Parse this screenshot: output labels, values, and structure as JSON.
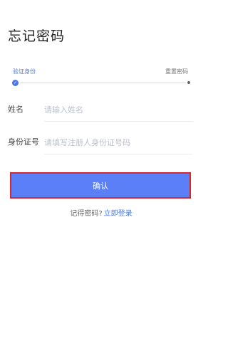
{
  "page": {
    "title": "忘记密码"
  },
  "steps": {
    "items": [
      {
        "label": "验证身份",
        "state": "active"
      },
      {
        "label": "重置密码",
        "state": "pending"
      }
    ],
    "check_glyph": "✓"
  },
  "form": {
    "name": {
      "label": "姓名",
      "value": "",
      "placeholder": "请输入姓名"
    },
    "id_number": {
      "label": "身份证号",
      "value": "",
      "placeholder": "请填写注册人身份证号码"
    }
  },
  "actions": {
    "confirm_label": "确认"
  },
  "footer": {
    "remember_text": "记得密码?",
    "login_link": "立即登录"
  },
  "colors": {
    "accent": "#4a78e6",
    "button": "#5b7ff6",
    "highlight_border": "#d9262a"
  }
}
